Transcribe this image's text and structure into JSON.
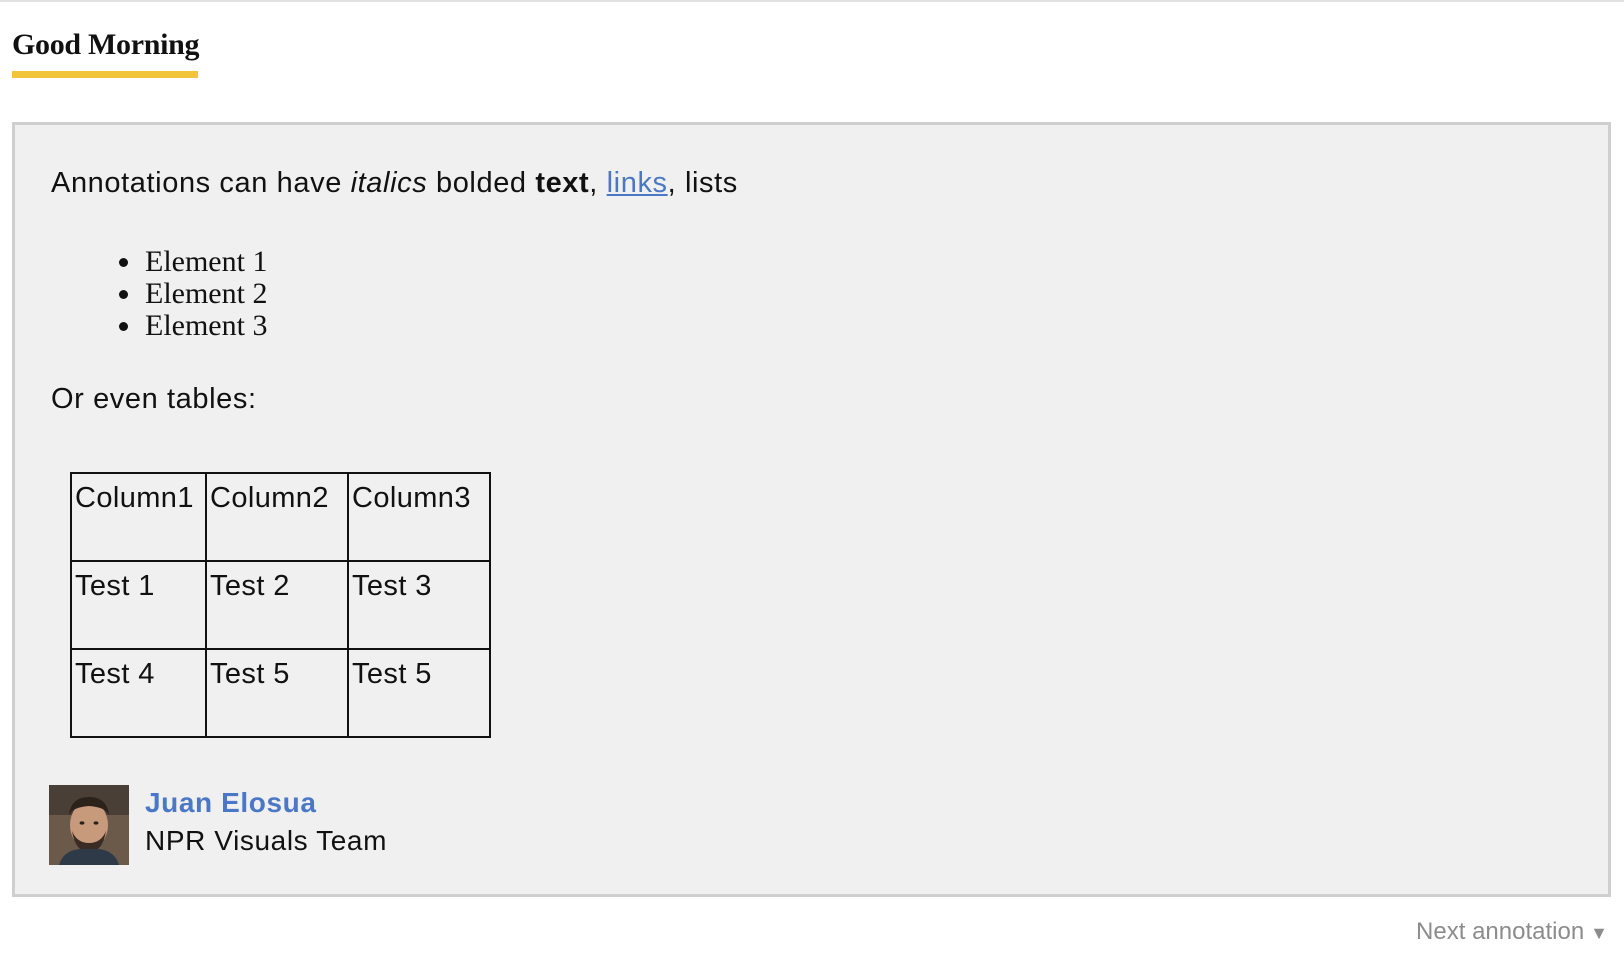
{
  "page": {
    "title": "Good Morning"
  },
  "annotation": {
    "intro_prefix": "Annotations can have ",
    "intro_italic": "italics",
    "intro_middle": " bolded ",
    "intro_bold": "text",
    "intro_comma": ", ",
    "intro_link": "links",
    "intro_suffix": ", lists",
    "list_items": [
      "Element 1",
      "Element 2",
      "Element 3"
    ],
    "tables_intro": "Or even tables:",
    "table": {
      "headers": [
        "Column1",
        "Column2",
        "Column3"
      ],
      "rows": [
        [
          "Test 1",
          "Test 2",
          "Test 3"
        ],
        [
          "Test 4",
          "Test 5",
          "Test 5"
        ]
      ]
    },
    "author": {
      "name": "Juan Elosua",
      "team": "NPR Visuals Team"
    }
  },
  "footer": {
    "next_label": "Next annotation",
    "next_icon": "triangle-down-icon"
  },
  "colors": {
    "title_underline": "#f0c53a",
    "link": "#4a78c6",
    "panel_background": "#f0f0f0",
    "panel_border": "#cfcfcf",
    "muted": "#8c8c8c"
  }
}
